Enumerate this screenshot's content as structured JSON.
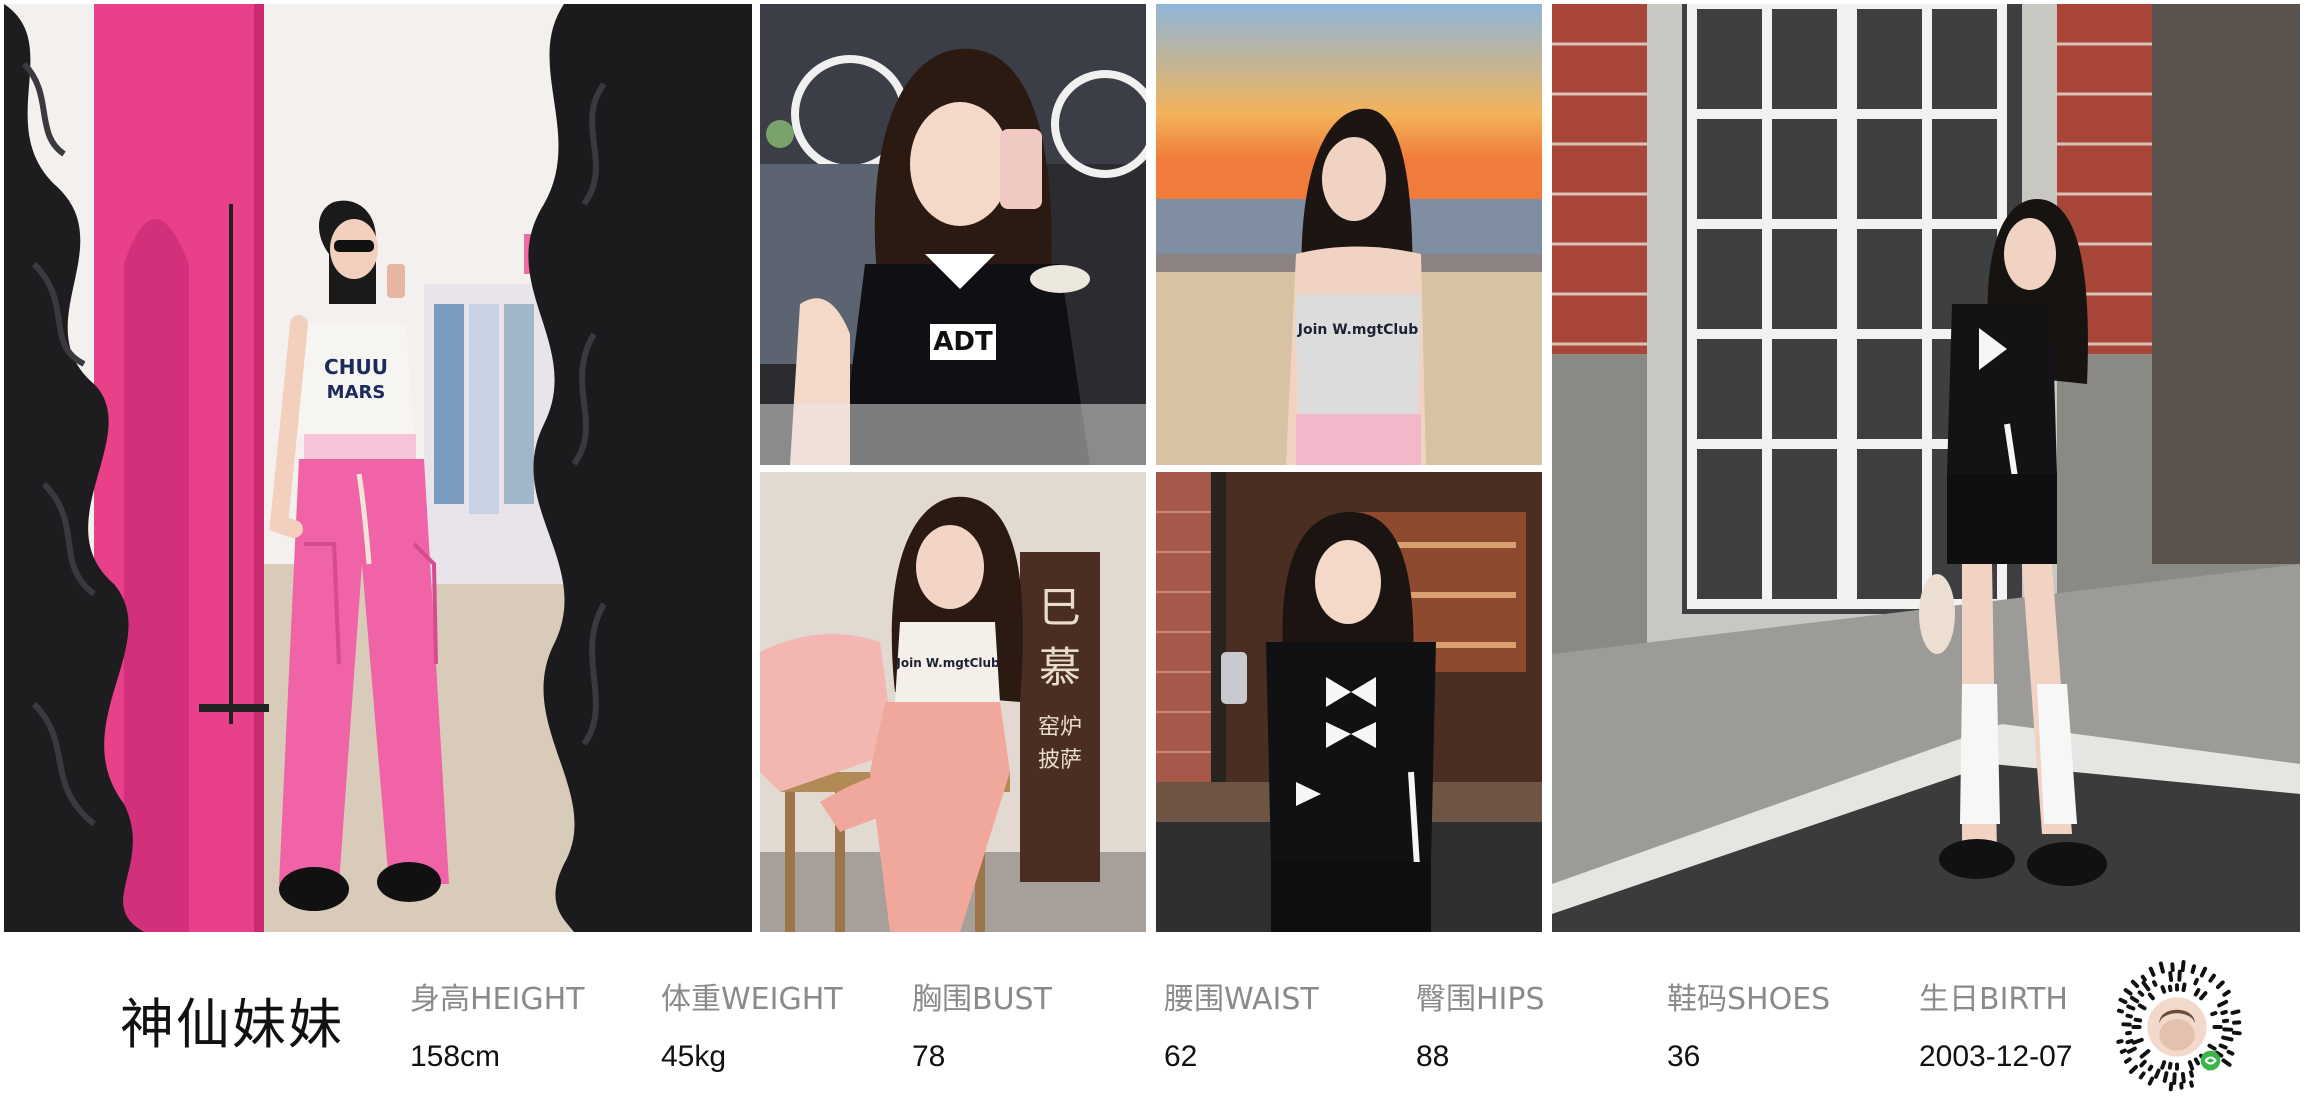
{
  "profile": {
    "name": "神仙妹妹",
    "stats": [
      {
        "label": "身高HEIGHT",
        "value": "158cm"
      },
      {
        "label": "体重WEIGHT",
        "value": "45kg"
      },
      {
        "label": "胸围BUST",
        "value": "78"
      },
      {
        "label": "腰围WAIST",
        "value": "62"
      },
      {
        "label": "臀围HIPS",
        "value": "88"
      },
      {
        "label": "鞋码SHOES",
        "value": "36"
      },
      {
        "label": "生日BIRTH",
        "value": "2003-12-07"
      }
    ]
  },
  "photos": {
    "p1": {
      "subject": "mirror-selfie-pink-cargo-pants",
      "shirt_text": "CHUU MARS"
    },
    "p2": {
      "subject": "selfie-black-tee",
      "shirt_text": "ADT"
    },
    "p3": {
      "subject": "beach-sunset-portrait",
      "shirt_text": "Join W.mgtClub"
    },
    "p4": {
      "subject": "seated-pink-outfit",
      "shirt_text": "Join W.mgtClub",
      "sign_text": "巳 慕 窑炉 披萨"
    },
    "p5": {
      "subject": "bar-doorway-black-bow-top"
    },
    "p6": {
      "subject": "brick-wall-french-door-full-body"
    }
  },
  "colors": {
    "pink_wall": "#e8418a",
    "pink_pants": "#f063a6",
    "sunset_orange": "#f5a343",
    "brick": "#a9463a",
    "black": "#111111",
    "label_gray": "#8a8a8a",
    "qr_badge": "#3bb54a"
  }
}
